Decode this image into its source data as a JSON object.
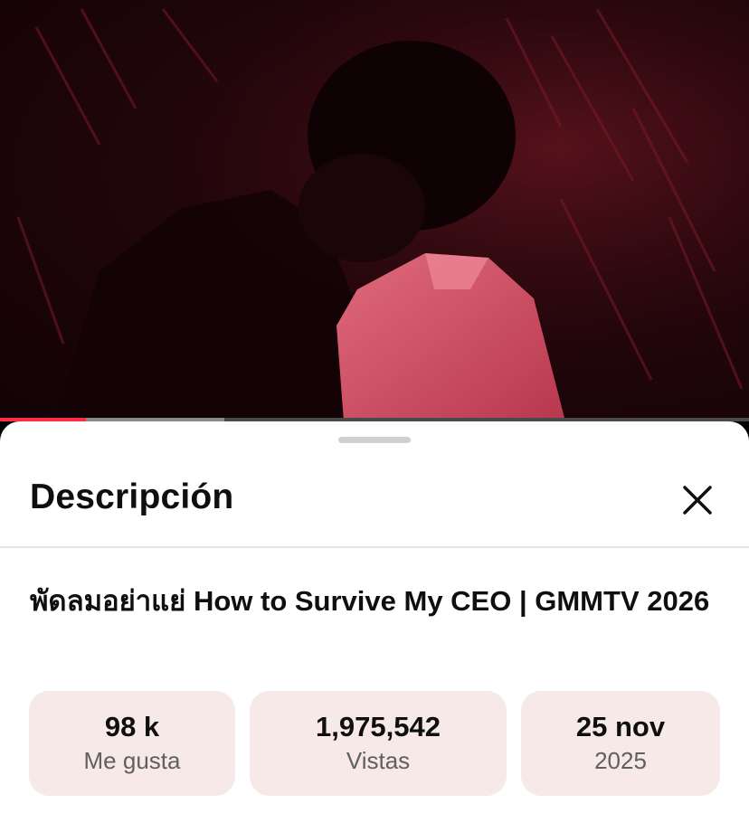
{
  "video": {
    "progress_played": 0.115,
    "progress_buffered": 0.3
  },
  "sheet": {
    "title": "Descripción",
    "video_title": "พัดลมอย่าแย่ How to Survive My CEO | GMMTV 2026"
  },
  "stats": [
    {
      "value": "98 k",
      "label": "Me gusta"
    },
    {
      "value": "1,975,542",
      "label": "Vistas"
    },
    {
      "value": "25 nov",
      "label": "2025"
    }
  ],
  "colors": {
    "progress_played": "#ff2b43",
    "stat_background": "#f6e9e7"
  },
  "icons": {
    "close": "close-icon"
  }
}
